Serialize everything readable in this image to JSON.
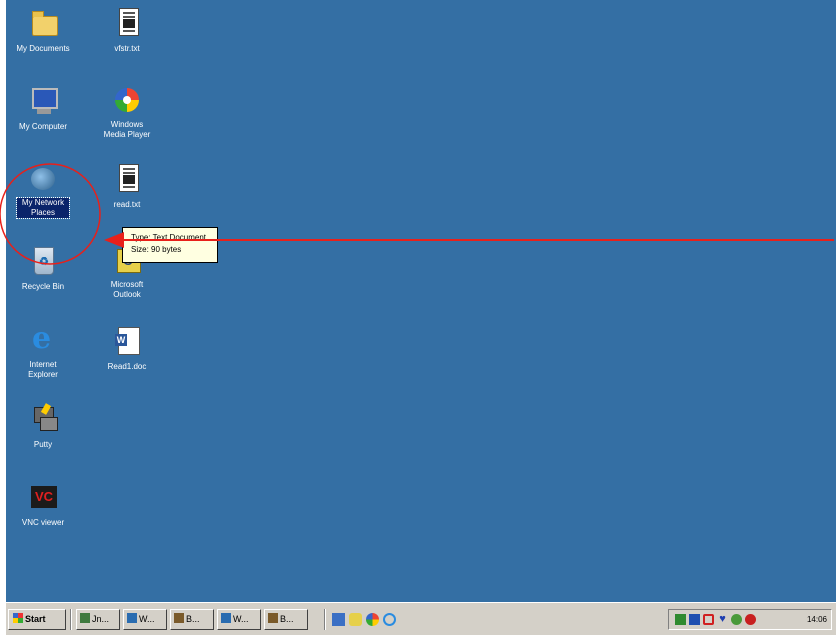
{
  "desktop": {
    "background_color": "#346fa4",
    "icons": [
      {
        "label": "My Documents",
        "icon": "folder-icon"
      },
      {
        "label": "vfstr.txt",
        "icon": "text-file-icon"
      },
      {
        "label": "My Computer",
        "icon": "computer-icon"
      },
      {
        "label": "Windows Media Player",
        "icon": "media-player-icon"
      },
      {
        "label": "My Network Places",
        "icon": "network-icon",
        "selected": true
      },
      {
        "label": "read.txt",
        "icon": "text-file-icon"
      },
      {
        "label": "Recycle Bin",
        "icon": "recycle-bin-icon"
      },
      {
        "label": "Microsoft Outlook",
        "icon": "outlook-icon"
      },
      {
        "label": "Internet Explorer",
        "icon": "ie-icon"
      },
      {
        "label": "Read1.doc",
        "icon": "word-doc-icon"
      },
      {
        "label": "Putty",
        "icon": "putty-icon"
      },
      {
        "label": "VNC viewer",
        "icon": "vnc-icon"
      }
    ]
  },
  "tooltip": {
    "line1": "Type: Text Document",
    "line2": "Size: 90 bytes"
  },
  "annotation": {
    "color": "#e8201a"
  },
  "taskbar": {
    "start_label": "Start",
    "buttons": [
      "Jn...",
      "W...",
      "B...",
      "W...",
      "B..."
    ],
    "quick_launch": [
      "desktop-icon",
      "outlook-icon",
      "media-icon",
      "ie-icon"
    ],
    "tray_icons": [
      "network-icon",
      "app-icon",
      "shield-icon",
      "heart-icon",
      "volume-icon",
      "stop-icon"
    ],
    "clock": "14:06"
  }
}
